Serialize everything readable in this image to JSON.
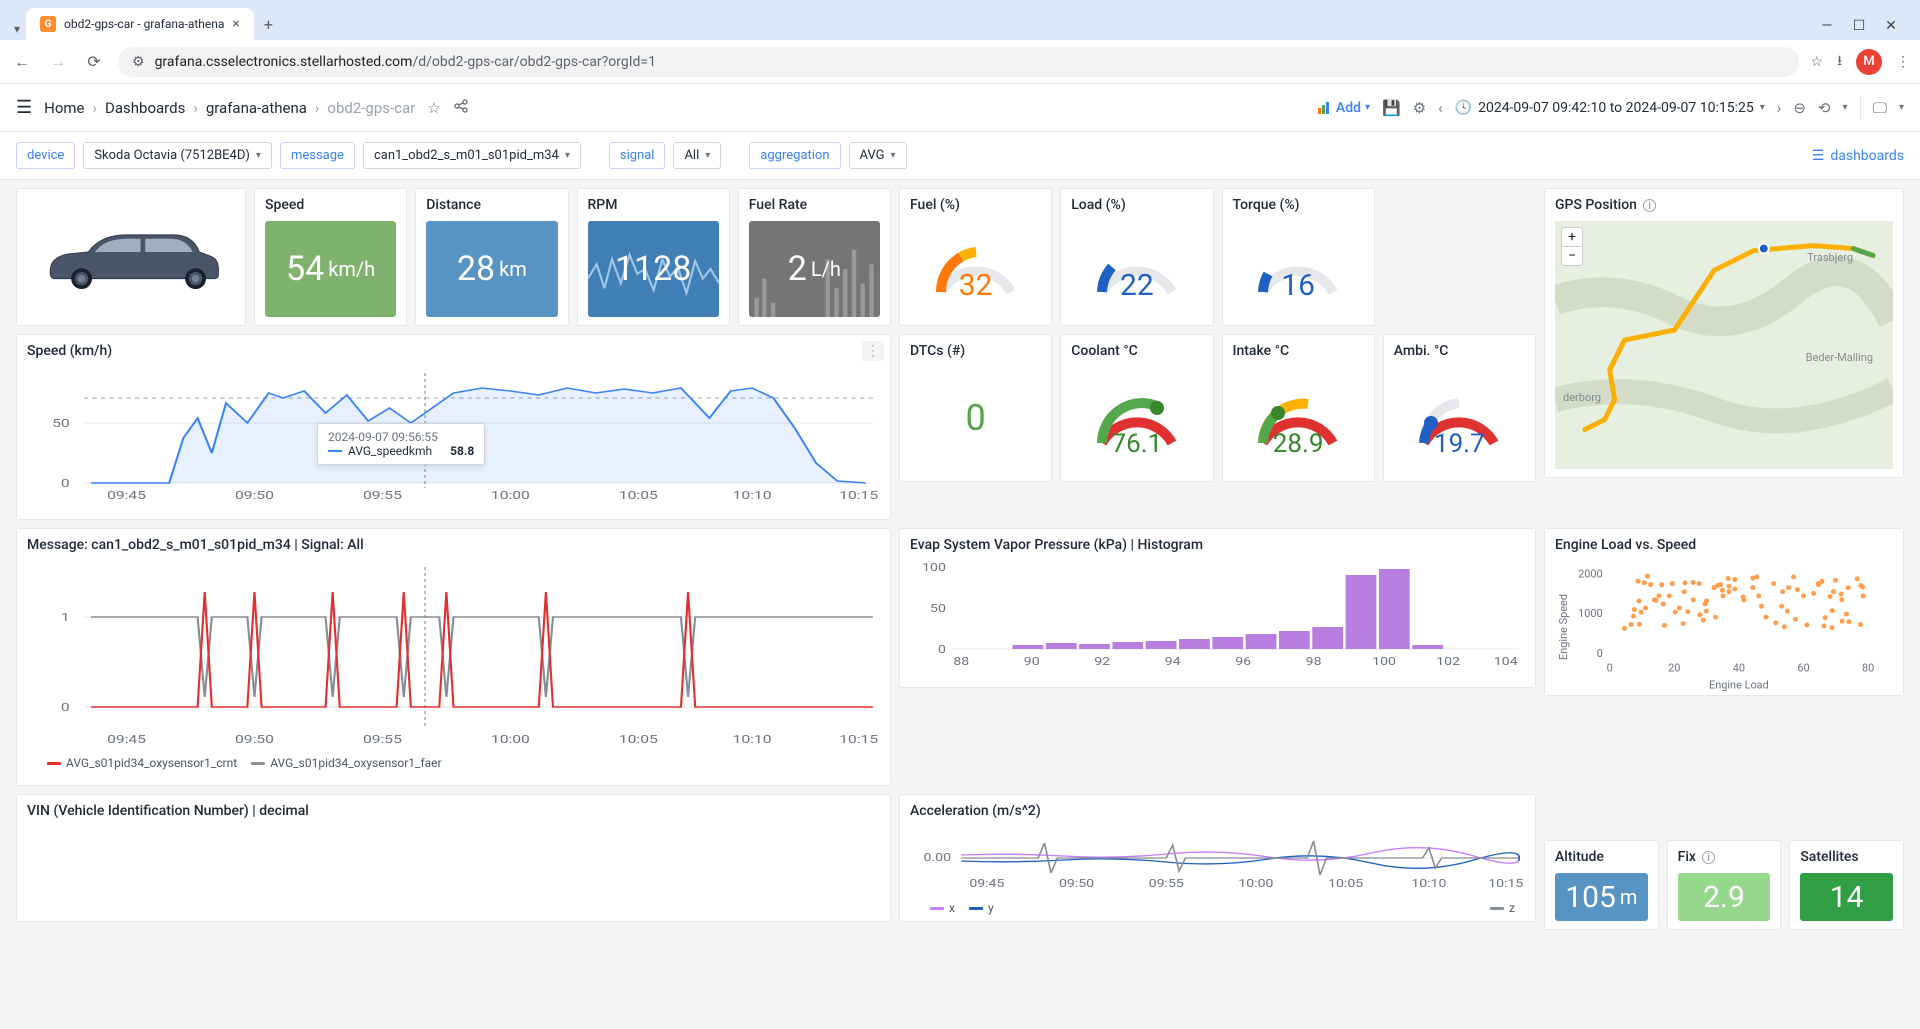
{
  "browser": {
    "tab_title": "obd2-gps-car - grafana-athena",
    "url_host": "grafana.csselectronics.stellarhosted.com",
    "url_path": "/d/obd2-gps-car/obd2-gps-car?orgId=1",
    "avatar_letter": "M"
  },
  "header": {
    "breadcrumb": [
      "Home",
      "Dashboards",
      "grafana-athena",
      "obd2-gps-car"
    ],
    "add_label": "Add",
    "time_range": "2024-09-07 09:42:10 to 2024-09-07 10:15:25"
  },
  "vars": {
    "device_label": "device",
    "device_value": "Skoda Octavia (7512BE4D)",
    "message_label": "message",
    "message_value": "can1_obd2_s_m01_s01pid_m34",
    "signal_label": "signal",
    "signal_value": "All",
    "aggregation_label": "aggregation",
    "aggregation_value": "AVG",
    "dashboards_link": "dashboards"
  },
  "stats": {
    "speed": {
      "title": "Speed",
      "value": "54",
      "unit": "km/h"
    },
    "distance": {
      "title": "Distance",
      "value": "28",
      "unit": "km"
    },
    "rpm": {
      "title": "RPM",
      "value": "1128"
    },
    "fuel_rate": {
      "title": "Fuel Rate",
      "value": "2",
      "unit": "L/h"
    },
    "fuel_pct": {
      "title": "Fuel (%)",
      "value": "32"
    },
    "load_pct": {
      "title": "Load (%)",
      "value": "22"
    },
    "torque_pct": {
      "title": "Torque (%)",
      "value": "16"
    },
    "dtcs": {
      "title": "DTCs (#)",
      "value": "0"
    },
    "coolant": {
      "title": "Coolant °C",
      "value": "76.1"
    },
    "intake": {
      "title": "Intake °C",
      "value": "28.9"
    },
    "ambi": {
      "title": "Ambi. °C",
      "value": "19.7"
    },
    "altitude": {
      "title": "Altitude",
      "value": "105",
      "unit": "m"
    },
    "fix": {
      "title": "Fix",
      "value": "2.9"
    },
    "satellites": {
      "title": "Satellites",
      "value": "14"
    }
  },
  "speed_chart": {
    "title": "Speed (km/h)",
    "tooltip_time": "2024-09-07 09:56:55",
    "tooltip_series": "AVG_speedkmh",
    "tooltip_value": "58.8",
    "x_ticks": [
      "09:45",
      "09:50",
      "09:55",
      "10:00",
      "10:05",
      "10:10",
      "10:15"
    ],
    "y_ticks": [
      "0",
      "50"
    ]
  },
  "msg_chart": {
    "title": "Message: can1_obd2_s_m01_s01pid_m34 | Signal: All",
    "legend": [
      "AVG_s01pid34_oxysensor1_crnt",
      "AVG_s01pid34_oxysensor1_faer"
    ],
    "x_ticks": [
      "09:45",
      "09:50",
      "09:55",
      "10:00",
      "10:05",
      "10:10",
      "10:15"
    ],
    "y_ticks": [
      "0",
      "1"
    ]
  },
  "evap": {
    "title": "Evap System Vapor Pressure (kPa) | Histogram",
    "x_ticks": [
      "88",
      "90",
      "92",
      "94",
      "96",
      "98",
      "100",
      "102",
      "104"
    ],
    "y_ticks": [
      "0",
      "50",
      "100"
    ]
  },
  "accel": {
    "title": "Acceleration (m/s^2)",
    "legend": [
      "x",
      "y",
      "z"
    ],
    "x_ticks": [
      "09:45",
      "09:50",
      "09:55",
      "10:00",
      "10:05",
      "10:10",
      "10:15"
    ],
    "y_ticks": [
      "0.00"
    ]
  },
  "gps": {
    "title": "GPS Position",
    "places": [
      "Trasbjerg",
      "Beder-Malling",
      "derborg"
    ]
  },
  "scatter": {
    "title": "Engine Load vs. Speed",
    "xlabel": "Engine Load",
    "ylabel": "Engine Speed",
    "x_ticks": [
      "0",
      "20",
      "40",
      "60",
      "80"
    ],
    "y_ticks": [
      "0",
      "1000",
      "2000"
    ]
  },
  "vin": {
    "title": "VIN (Vehicle Identification Number) | decimal"
  },
  "chart_data": {
    "speed_timeseries": {
      "type": "line",
      "xlabel": "time",
      "ylabel": "km/h",
      "ylim": [
        0,
        100
      ],
      "x": [
        "09:43",
        "09:45",
        "09:47",
        "09:48",
        "09:49",
        "09:50",
        "09:51",
        "09:52",
        "09:53",
        "09:54",
        "09:55",
        "09:56",
        "09:57",
        "09:58",
        "09:59",
        "10:00",
        "10:01",
        "10:02",
        "10:03",
        "10:04",
        "10:05",
        "10:06",
        "10:07",
        "10:08",
        "10:09",
        "10:10",
        "10:11",
        "10:12",
        "10:13",
        "10:14",
        "10:15"
      ],
      "values": [
        0,
        0,
        0,
        40,
        55,
        30,
        65,
        50,
        75,
        70,
        78,
        60,
        58.8,
        48,
        75,
        80,
        82,
        78,
        80,
        76,
        82,
        80,
        78,
        82,
        55,
        78,
        80,
        70,
        45,
        10,
        0
      ]
    },
    "message_timeseries": {
      "type": "line",
      "series": [
        {
          "name": "AVG_s01pid34_oxysensor1_crnt",
          "color": "#e03131",
          "values": [
            0,
            0,
            0,
            0.1,
            1.2,
            0,
            0,
            1.2,
            0,
            0,
            0,
            1.2,
            0,
            1.2,
            0,
            0,
            1.2,
            0,
            0,
            0,
            1.2,
            0,
            0,
            0,
            0,
            1.2,
            0,
            0,
            0,
            0,
            0
          ]
        },
        {
          "name": "AVG_s01pid34_oxysensor1_faer",
          "color": "#868e96",
          "values": [
            1,
            1,
            1,
            1,
            0.3,
            1,
            1,
            0.3,
            1,
            1,
            1,
            0.3,
            1,
            0.3,
            1,
            1,
            0.3,
            1,
            1,
            1,
            0.3,
            1,
            1,
            1,
            1,
            0.3,
            1,
            1,
            1,
            1,
            1
          ]
        }
      ],
      "x": [
        "09:43",
        "09:45",
        "09:47",
        "09:48",
        "09:49",
        "09:50",
        "09:51",
        "09:52",
        "09:53",
        "09:54",
        "09:55",
        "09:56",
        "09:57",
        "09:58",
        "09:59",
        "10:00",
        "10:01",
        "10:02",
        "10:03",
        "10:04",
        "10:05",
        "10:06",
        "10:07",
        "10:08",
        "10:09",
        "10:10",
        "10:11",
        "10:12",
        "10:13",
        "10:14",
        "10:15"
      ],
      "ylim": [
        -0.3,
        1.3
      ]
    },
    "evap_histogram": {
      "type": "bar",
      "categories": [
        88,
        89,
        90,
        91,
        92,
        93,
        94,
        95,
        96,
        97,
        98,
        99,
        100,
        101,
        102,
        103
      ],
      "values": [
        0,
        0,
        2,
        4,
        3,
        5,
        4,
        6,
        8,
        12,
        15,
        18,
        22,
        85,
        92,
        4
      ],
      "xlim": [
        88,
        104
      ],
      "ylim": [
        0,
        100
      ]
    },
    "acceleration_timeseries": {
      "type": "line",
      "series": [
        {
          "name": "x",
          "color": "#c77dff"
        },
        {
          "name": "y",
          "color": "#1f60c4"
        },
        {
          "name": "z",
          "color": "#868e96"
        }
      ],
      "ylim": [
        -0.5,
        0.5
      ],
      "center": 0.0
    },
    "engine_load_vs_speed": {
      "type": "scatter",
      "xlabel": "Engine Load",
      "ylabel": "Engine Speed",
      "xlim": [
        0,
        90
      ],
      "ylim": [
        0,
        2200
      ],
      "points_sample": [
        [
          5,
          700
        ],
        [
          8,
          1000
        ],
        [
          10,
          800
        ],
        [
          12,
          1200
        ],
        [
          15,
          1400
        ],
        [
          18,
          1300
        ],
        [
          20,
          1500
        ],
        [
          22,
          1100
        ],
        [
          25,
          1600
        ],
        [
          28,
          1400
        ],
        [
          30,
          1800
        ],
        [
          32,
          1300
        ],
        [
          35,
          1700
        ],
        [
          38,
          1500
        ],
        [
          40,
          1600
        ],
        [
          42,
          1900
        ],
        [
          45,
          1400
        ],
        [
          48,
          1700
        ],
        [
          50,
          1500
        ],
        [
          55,
          1800
        ],
        [
          58,
          1600
        ],
        [
          60,
          1700
        ],
        [
          65,
          1500
        ],
        [
          70,
          1800
        ],
        [
          75,
          1600
        ],
        [
          80,
          1700
        ],
        [
          85,
          1500
        ]
      ]
    }
  }
}
